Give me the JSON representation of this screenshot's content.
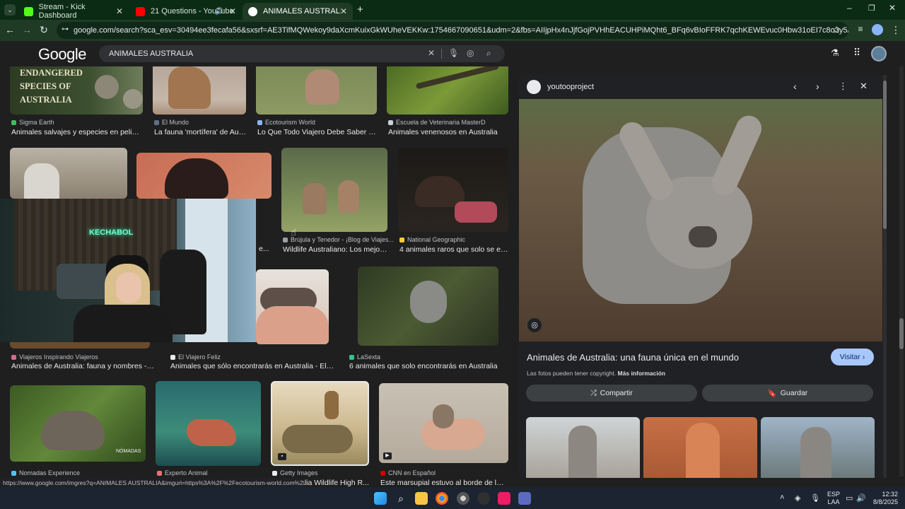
{
  "browser": {
    "tabs": [
      {
        "title": "Stream - Kick Dashboard"
      },
      {
        "title": "21 Questions - YouTube"
      },
      {
        "title": "ANIMALES AUSTRALIA - Busca"
      }
    ],
    "new_tab_label": "+",
    "url": "google.com/search?sca_esv=30494ee3fecafa56&sxsrf=AE3TifMQWekoy9daXcmKuixGkWUheVEKKw:1754667090651&udm=2&fbs=AIIjpHx4nJjfGojPVHhEACUHPiMQht6_BFq6vBIoFFRK7qchKEWEvuc0Hbw31oEI7c8o3y5Az9dJyKxsfx0xXZG1h0pUgSbCYZ7LGbQ..."
  },
  "google": {
    "logo": "Google",
    "query": "ANIMALES AUSTRALIA"
  },
  "results": [
    {
      "source": "Sigma Earth",
      "caption": "Animales salvajes y especies en peligro ...",
      "overlay": "ENDANGERED SPECIES OF AUSTRALIA"
    },
    {
      "source": "El Mundo",
      "caption": "La fauna 'mortífera' de Aust..."
    },
    {
      "source": "Ecotourism World",
      "caption": "Lo Que Todo Viajero Debe Saber So..."
    },
    {
      "source": "Escuela de Veterinaria MasterD",
      "caption": "Animales venenosos en Australia"
    },
    {
      "source": "",
      "caption": "e..."
    },
    {
      "source": "Brújula y Tenedor - ¡Blog de Viajes...",
      "caption": "Wildlife Australiano: Los mejore..."
    },
    {
      "source": "National Geographic",
      "caption": "4 animales raros que solo se enc..."
    },
    {
      "source": "Viajeros Inspirando Viajeros",
      "caption": "Animales de Australia: fauna y nombres - Viaj..."
    },
    {
      "source": "El Viajero Feliz",
      "caption": "Animales que sólo encontrarás en Australia - El Viaj..."
    },
    {
      "source": "LaSexta",
      "caption": "6 animales que solo encontrarás en Australia"
    },
    {
      "source": "Nomadas Experience",
      "caption": "",
      "overlay": "NÓMADAS"
    },
    {
      "source": "Experto Animal",
      "caption": ""
    },
    {
      "source": "Getty Images",
      "caption": "alia Wildlife High R..."
    },
    {
      "source": "CNN en Español",
      "caption": "Este marsupial estuvo al borde de la ex..."
    }
  ],
  "panel": {
    "site": "youtooproject",
    "title": "Animales de Australia: una fauna única en el mundo",
    "visit_label": "Visitar",
    "copyright": "Las fotos pueden tener copyright.",
    "more_info": "Más información",
    "share_label": "Compartir",
    "save_label": "Guardar"
  },
  "webcam": {
    "sign": "KECHABOL"
  },
  "status_url": "https://www.google.com/imgres?q=ANIMALES AUSTRALIA&imgurl=https%3A%2F%2Fecotourism-world.com%2Fwp...",
  "taskbar": {
    "lang1": "ESP",
    "lang2": "LAA",
    "time": "12:32",
    "date": "8/8/2025"
  },
  "colors": {
    "accent": "#8ab4f8",
    "visit_bg": "#a8c7fa"
  }
}
